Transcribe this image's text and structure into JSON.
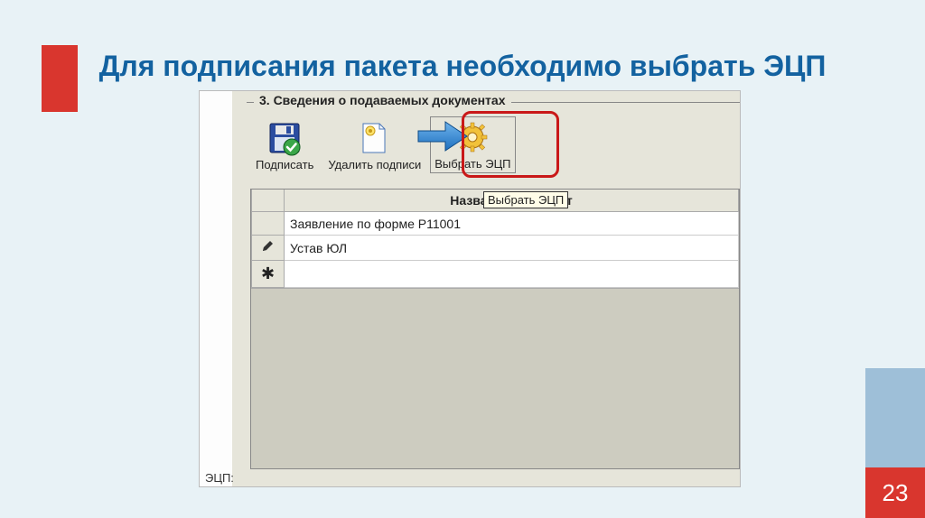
{
  "slide": {
    "title": "Для подписания пакета необходимо выбрать ЭЦП",
    "page_number": "23"
  },
  "fieldset": {
    "title": "3.  Сведения о подаваемых документах"
  },
  "toolbar": {
    "sign_label": "Подписать",
    "delete_sig_label": "Удалить подписи",
    "select_ecp_label": "Выбрать ЭЦП"
  },
  "tooltip": "Выбрать ЭЦП",
  "grid": {
    "header_name": "Название документ",
    "rows": [
      {
        "marker": "",
        "name": "Заявление по форме Р11001"
      },
      {
        "marker": "pencil",
        "name": "Устав ЮЛ"
      },
      {
        "marker": "star",
        "name": ""
      }
    ]
  },
  "footer_fragment": "ЭЦП:"
}
